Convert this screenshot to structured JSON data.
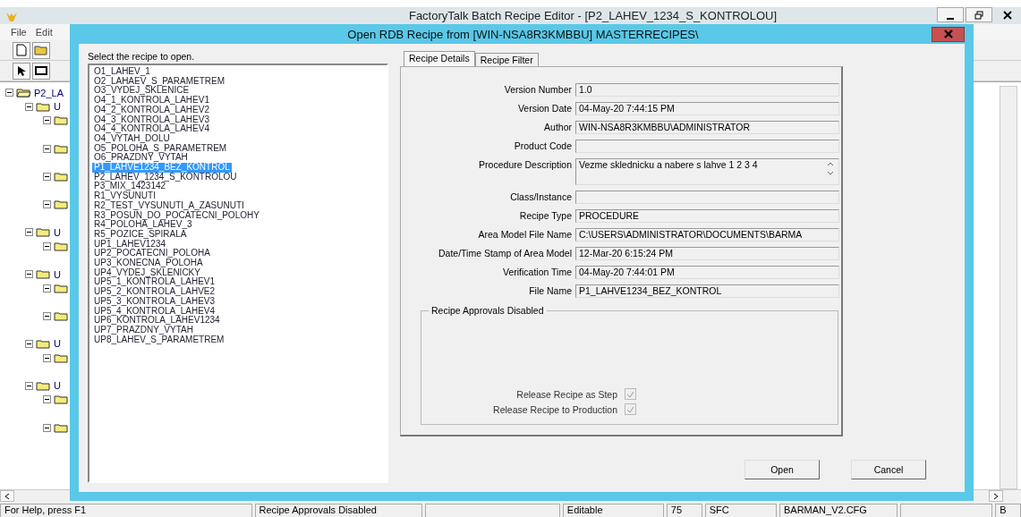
{
  "window": {
    "title": "FactoryTalk Batch Recipe Editor - [P2_LAHEV_1234_S_KONTROLOU]"
  },
  "menu": [
    "File",
    "Edit"
  ],
  "tree": {
    "label": "P2_LA",
    "expanded": true,
    "children": [
      {
        "label": "U",
        "expanded": true,
        "children": [
          {
            "expanded": true
          },
          {
            "expanded": true
          },
          {
            "expanded": true
          },
          {
            "expanded": true
          }
        ]
      },
      {
        "label": "U",
        "expanded": true,
        "children": [
          {
            "expanded": true
          }
        ]
      },
      {
        "label": "U",
        "expanded": true,
        "children": [
          {
            "expanded": true
          },
          {
            "expanded": true
          }
        ]
      },
      {
        "label": "U",
        "expanded": true,
        "children": [
          {
            "expanded": true
          }
        ]
      },
      {
        "label": "U",
        "expanded": true,
        "children": [
          {
            "expanded": true
          },
          {
            "expanded": true
          }
        ]
      }
    ]
  },
  "dialog": {
    "title": "Open RDB Recipe from  [WIN-NSA8R3KMBBU] MASTERRECIPES\\",
    "prompt": "Select the recipe to open.",
    "recipes": [
      {
        "name": "O1_LAHEV_1",
        "selected": false
      },
      {
        "name": "O2_LAHAEV_S_PARAMETREM",
        "selected": false
      },
      {
        "name": "O3_VYDEJ_SKLENICE",
        "selected": false
      },
      {
        "name": "O4_1_KONTROLA_LAHEV1",
        "selected": false
      },
      {
        "name": "O4_2_KONTROLA_LAHEV2",
        "selected": false
      },
      {
        "name": "O4_3_KONTROLA_LAHEV3",
        "selected": false
      },
      {
        "name": "O4_4_KONTROLA_LAHEV4",
        "selected": false
      },
      {
        "name": "O4_VYTAH_DOLU",
        "selected": false
      },
      {
        "name": "O5_POLOHA_S_PARAMETREM",
        "selected": false
      },
      {
        "name": "O6_PRAZDNY_VYTAH",
        "selected": false
      },
      {
        "name": "P1_LAHVE1234_BEZ_KONTROL",
        "selected": true
      },
      {
        "name": "P2_LAHEV_1234_S_KONTROLOU",
        "selected": false
      },
      {
        "name": "P3_MIX_1423142",
        "selected": false
      },
      {
        "name": "R1_VYSUNUTI",
        "selected": false
      },
      {
        "name": "R2_TEST_VYSUNUTI_A_ZASUNUTI",
        "selected": false
      },
      {
        "name": "R3_POSUN_DO_POCATECNI_POLOHY",
        "selected": false
      },
      {
        "name": "R4_POLOHA_LAHEV_3",
        "selected": false
      },
      {
        "name": "R5_POZICE_SPIRALA",
        "selected": false
      },
      {
        "name": "UP1_LAHEV1234",
        "selected": false
      },
      {
        "name": "UP2_POCATECNI_POLOHA",
        "selected": false
      },
      {
        "name": "UP3_KONECNA_POLOHA",
        "selected": false
      },
      {
        "name": "UP4_VYDEJ_SKLENICKY",
        "selected": false
      },
      {
        "name": "UP5_1_KONTROLA_LAHEV1",
        "selected": false
      },
      {
        "name": "UP5_2_KONTROLA_LAHVE2",
        "selected": false
      },
      {
        "name": "UP5_3_KONTROLA_LAHEV3",
        "selected": false
      },
      {
        "name": "UP5_4_KONTROLA_LAHEV4",
        "selected": false
      },
      {
        "name": "UP6_KONTROLA_LAHEV1234",
        "selected": false
      },
      {
        "name": "UP7_PRAZDNY_VYTAH",
        "selected": false
      },
      {
        "name": "UP8_LAHEV_S_PARAMETREM",
        "selected": false
      }
    ],
    "tabs": [
      {
        "label": "Recipe Details",
        "selected": true
      },
      {
        "label": "Recipe Filter",
        "selected": false
      }
    ],
    "fields": [
      {
        "label": "Version Number",
        "value": "1.0",
        "kind": "line"
      },
      {
        "label": "Version Date",
        "value": "04-May-20 7:44:15 PM",
        "kind": "line"
      },
      {
        "label": "Author",
        "value": "WIN-NSA8R3KMBBU\\ADMINISTRATOR",
        "kind": "line"
      },
      {
        "label": "Product Code",
        "kind": "line"
      },
      {
        "label": "Procedure Description",
        "value": "Vezme sklednicku a nabere s lahve 1 2 3 4",
        "kind": "multiline"
      },
      {
        "label": "Class/Instance",
        "kind": "line"
      },
      {
        "label": "Recipe Type",
        "value": "PROCEDURE",
        "kind": "line"
      },
      {
        "label": "Area Model File Name",
        "value": "C:\\USERS\\ADMINISTRATOR\\DOCUMENTS\\BARMA",
        "kind": "line"
      },
      {
        "label": "Date/Time Stamp of Area Model",
        "value": "12-Mar-20 6:15:24 PM",
        "kind": "line"
      },
      {
        "label": "Verification Time",
        "value": "04-May-20 7:44:01 PM",
        "kind": "line"
      },
      {
        "label": "File Name",
        "value": "P1_LAHVE1234_BEZ_KONTROL",
        "kind": "line"
      }
    ],
    "approvals": {
      "title": "Recipe Approvals Disabled",
      "options": [
        {
          "label": "Release Recipe as Step",
          "checked": true,
          "disabled": true
        },
        {
          "label": "Release Recipe to Production",
          "checked": true,
          "disabled": true
        }
      ]
    },
    "buttons": [
      "Open",
      "Cancel"
    ]
  },
  "status_bar": [
    "For Help, press F1",
    "Recipe Approvals Disabled",
    "Editable",
    "75",
    "SFC",
    "BARMAN_V2.CFG",
    "B"
  ]
}
